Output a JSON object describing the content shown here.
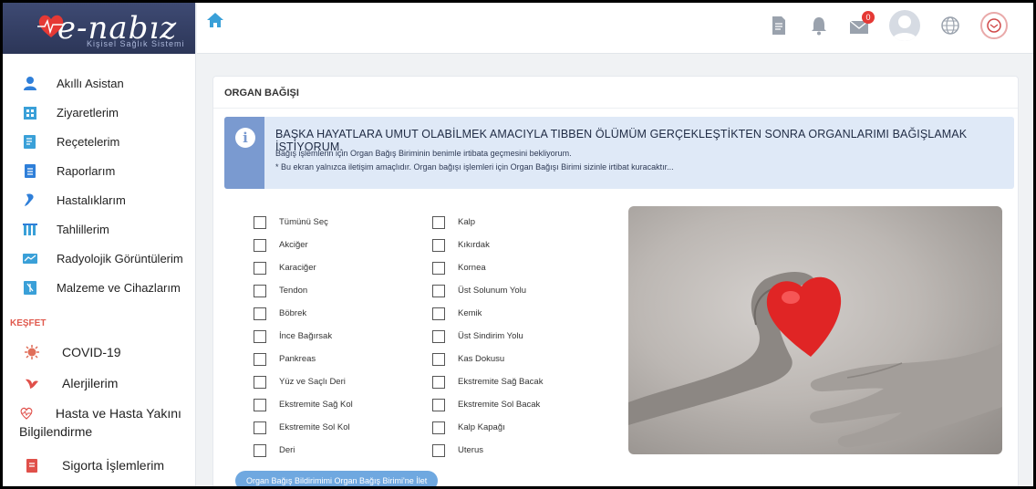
{
  "app": {
    "logo_text": "e-nabız",
    "logo_subtitle": "Kişisel Sağlık Sistemi"
  },
  "topbar": {
    "notification_count": "0",
    "icons": [
      "home-icon",
      "document-icon",
      "bell-icon",
      "mail-icon",
      "avatar",
      "globe-icon",
      "ministry-logo"
    ]
  },
  "sidebar": {
    "items": [
      {
        "label": "Akıllı Asistan",
        "icon": "assistant-icon",
        "color": "#2f7fd9"
      },
      {
        "label": "Ziyaretlerim",
        "icon": "hospital-icon",
        "color": "#3aa0d8"
      },
      {
        "label": "Reçetelerim",
        "icon": "prescription-icon",
        "color": "#3aa0d8"
      },
      {
        "label": "Raporlarım",
        "icon": "report-icon",
        "color": "#2f7fd9"
      },
      {
        "label": "Hastalıklarım",
        "icon": "disease-icon",
        "color": "#2f7fd9"
      },
      {
        "label": "Tahlillerim",
        "icon": "lab-icon",
        "color": "#3aa0d8"
      },
      {
        "label": "Radyolojik Görüntülerim",
        "icon": "radiology-icon",
        "color": "#3aa0d8"
      },
      {
        "label": "Malzeme ve Cihazlarım",
        "icon": "device-icon",
        "color": "#3aa0d8"
      }
    ],
    "section_title": "KEŞFET",
    "explore_items": [
      {
        "label": "COVID-19",
        "icon": "virus-icon",
        "color": "#e06f5a"
      },
      {
        "label": "Alerjilerim",
        "icon": "allergy-icon",
        "color": "#e0504a"
      },
      {
        "label": "Hasta ve Hasta Yakını Bilgilendirme",
        "icon": "heart-outline-icon",
        "color": "#e0504a"
      },
      {
        "label": "Sigorta İşlemlerim",
        "icon": "insurance-icon",
        "color": "#e0504a"
      }
    ]
  },
  "page": {
    "title": "ORGAN BAĞIŞI",
    "info": {
      "heading": "BAŞKA HAYATLARA UMUT OLABİLMEK AMACIYLA TIBBEN ÖLÜMÜM GERÇEKLEŞTİKTEN SONRA ORGANLARIMI BAĞIŞLAMAK İSTİYORUM.",
      "line1": "Bağış işlemlerin için Organ Bağış Biriminin benimle irtibata geçmesini bekliyorum.",
      "line2": "* Bu ekran yalnızca iletişim amaçlıdır. Organ bağışı işlemleri için Organ Bağışı Birimi sizinle irtibat kuracaktır..."
    },
    "organs_left": [
      "Tümünü Seç",
      "Akciğer",
      "Karaciğer",
      "Tendon",
      "Böbrek",
      "İnce Bağırsak",
      "Pankreas",
      "Yüz ve Saçlı Deri",
      "Ekstremite Sağ Kol",
      "Ekstremite Sol Kol",
      "Deri"
    ],
    "organs_right": [
      "Kalp",
      "Kıkırdak",
      "Kornea",
      "Üst Solunum Yolu",
      "Kemik",
      "Üst Sindirim Yolu",
      "Kas Dokusu",
      "Ekstremite Sağ Bacak",
      "Ekstremite Sol Bacak",
      "Kalp Kapağı",
      "Uterus"
    ],
    "submit_label": "Organ Bağış Bildirimimi Organ Bağış Birimi'ne İlet",
    "accent_color": "#6fa8e0"
  }
}
